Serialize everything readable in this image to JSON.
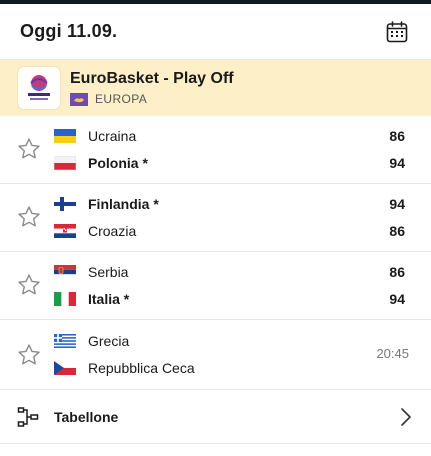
{
  "header": {
    "date": "Oggi 11.09.",
    "calendar_icon": "calendar-icon"
  },
  "competition": {
    "title": "EuroBasket - Play Off",
    "region": "EUROPA",
    "logo_icon": "eurobasket-logo-icon",
    "region_flag_icon": "europe-flag-icon"
  },
  "matches": [
    {
      "home": {
        "name": "Ucraina",
        "score": "86"
      },
      "away": {
        "name": "Polonia *",
        "score": "94"
      }
    },
    {
      "home": {
        "name": "Finlandia *",
        "score": "94"
      },
      "away": {
        "name": "Croazia",
        "score": "86"
      }
    },
    {
      "home": {
        "name": "Serbia",
        "score": "86"
      },
      "away": {
        "name": "Italia *",
        "score": "94"
      }
    },
    {
      "home": {
        "name": "Grecia"
      },
      "away": {
        "name": "Repubblica Ceca"
      },
      "time": "20:45"
    }
  ],
  "footer": {
    "label": "Tabellone",
    "icon": "bracket-icon",
    "chevron": "chevron-right-icon"
  }
}
